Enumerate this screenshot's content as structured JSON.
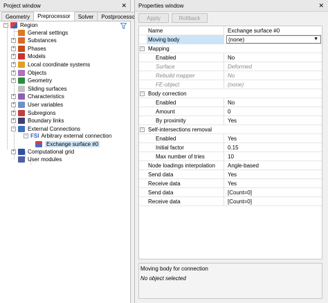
{
  "project_window": {
    "title": "Project window",
    "tabs": [
      "Geometry",
      "Preprocessor",
      "Solver",
      "Postprocessor"
    ],
    "active_tab": "Preprocessor",
    "tree": {
      "region": "Region",
      "items": [
        {
          "label": "General settings",
          "icon": "settings-icon",
          "color": "#e07820"
        },
        {
          "label": "Substances",
          "icon": "substances-icon",
          "color": "#d86a2a"
        },
        {
          "label": "Phases",
          "icon": "phases-icon",
          "color": "#c44c1c"
        },
        {
          "label": "Models",
          "icon": "models-icon",
          "color": "#c83232"
        },
        {
          "label": "Local coordinate systems",
          "icon": "coordinates-icon",
          "color": "#e0a020"
        },
        {
          "label": "Objects",
          "icon": "objects-icon",
          "color": "#b070c0"
        },
        {
          "label": "Geometry",
          "icon": "geometry-icon",
          "color": "#2c8c3c"
        },
        {
          "label": "Sliding surfaces",
          "icon": "sliding-icon",
          "color": "#c0c0c0"
        },
        {
          "label": "Characteristics",
          "icon": "characteristics-icon",
          "color": "#9060b0"
        },
        {
          "label": "User variables",
          "icon": "user-variables-icon",
          "color": "#7090c8"
        },
        {
          "label": "Subregions",
          "icon": "subregions-icon",
          "color": "#c04040"
        },
        {
          "label": "Boundary links",
          "icon": "boundary-links-icon",
          "color": "#404070"
        },
        {
          "label": "External Connections",
          "icon": "connections-icon",
          "color": "#4070c0"
        }
      ],
      "fsi_prefix": "FSI",
      "arbitrary": "Arbitrary external connection",
      "exchange": "Exchange surface #0",
      "after": [
        {
          "label": "Computational grid",
          "icon": "grid-icon",
          "color": "#3050a0"
        },
        {
          "label": "User modules",
          "icon": "modules-icon",
          "color": "#5060a0"
        }
      ]
    }
  },
  "properties_window": {
    "title": "Properties window",
    "apply": "Apply",
    "rollback": "Rollback",
    "rows": {
      "name_label": "Name",
      "name_value": "Exchange surface #0",
      "moving_label": "Moving body",
      "moving_value": "(none)",
      "mapping": "Mapping",
      "m_enabled_label": "Enabled",
      "m_enabled_value": "No",
      "surface_label": "Surface",
      "surface_value": "Deformed",
      "rebuild_label": "Rebuild mapper",
      "rebuild_value": "No",
      "feobject_label": "FE-object",
      "feobject_value": "(none)",
      "body": "Body correction",
      "b_enabled_label": "Enabled",
      "b_enabled_value": "No",
      "amount_label": "Amount",
      "amount_value": "0",
      "proximity_label": "By proximity",
      "proximity_value": "Yes",
      "self": "Self-intersections removal",
      "s_enabled_label": "Enabled",
      "s_enabled_value": "Yes",
      "initial_label": "Initial factor",
      "initial_value": "0.15",
      "maxtries_label": "Max number of tries",
      "maxtries_value": "10",
      "nodeint_label": "Node loadings interpolation",
      "nodeint_value": "Angle-based",
      "send_label": "Send data",
      "send_value": "Yes",
      "receive_label": "Receive data",
      "receive_value": "Yes",
      "send2_label": "Send data",
      "send2_value": "[Count=0]",
      "receive2_label": "Receive data",
      "receive2_value": "[Count=0]"
    },
    "help": {
      "title": "Moving body for connection",
      "desc": "No object selected"
    }
  }
}
